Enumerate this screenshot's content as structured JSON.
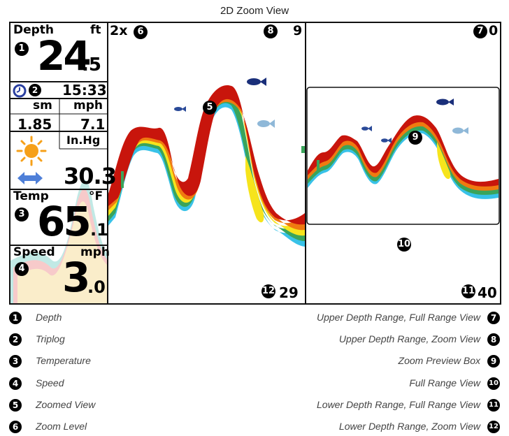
{
  "title": "2D Zoom View",
  "sidebar": {
    "depth_label": "Depth",
    "depth_unit": "ft",
    "depth_int": "24",
    "depth_dec": ".5",
    "time": "15:33",
    "speed_unit_sm": "sm",
    "speed_unit_mph": "mph",
    "triplog_sm": "1.85",
    "triplog_mph": "7.1",
    "pressure_unit": "In.Hg",
    "pressure_value": "30.3",
    "temp_label": "Temp",
    "temp_unit": "°F",
    "temp_int": "65",
    "temp_dec": ".1",
    "speed_label": "Speed",
    "speed_int": "3",
    "speed_dec": ".0"
  },
  "zoom_panel": {
    "zoom_level": "2x",
    "upper_depth": "9",
    "lower_depth": "29"
  },
  "full_panel": {
    "upper_depth": "0",
    "lower_depth": "40"
  },
  "callouts": {
    "c1": "1",
    "c2": "2",
    "c3": "3",
    "c4": "4",
    "c5": "5",
    "c6": "6",
    "c7": "7",
    "c8": "8",
    "c9": "9",
    "c10": "10",
    "c11": "11",
    "c12": "12"
  },
  "legend": {
    "left": [
      {
        "num": "1",
        "text": "Depth"
      },
      {
        "num": "2",
        "text": "Triplog"
      },
      {
        "num": "3",
        "text": "Temperature"
      },
      {
        "num": "4",
        "text": "Speed"
      },
      {
        "num": "5",
        "text": "Zoomed View"
      },
      {
        "num": "6",
        "text": "Zoom Level"
      }
    ],
    "right": [
      {
        "num": "7",
        "text": "Upper Depth Range, Full Range View"
      },
      {
        "num": "8",
        "text": "Upper Depth Range, Zoom View"
      },
      {
        "num": "9",
        "text": "Zoom Preview Box"
      },
      {
        "num": "10",
        "text": "Full Range View"
      },
      {
        "num": "11",
        "text": "Lower Depth Range, Full Range View"
      },
      {
        "num": "12",
        "text": "Lower Depth Range, Zoom View"
      }
    ]
  },
  "colors": {
    "sonar_red": "#c8150c",
    "sonar_orange": "#f07a10",
    "sonar_yellow": "#f6e41c",
    "sonar_green": "#3aa45a",
    "sonar_cyan": "#38c2e8",
    "fish_dark": "#1a2f7a",
    "fish_light": "#8fb8d8",
    "sun": "#f6a019",
    "arrow": "#4e7fd8"
  }
}
